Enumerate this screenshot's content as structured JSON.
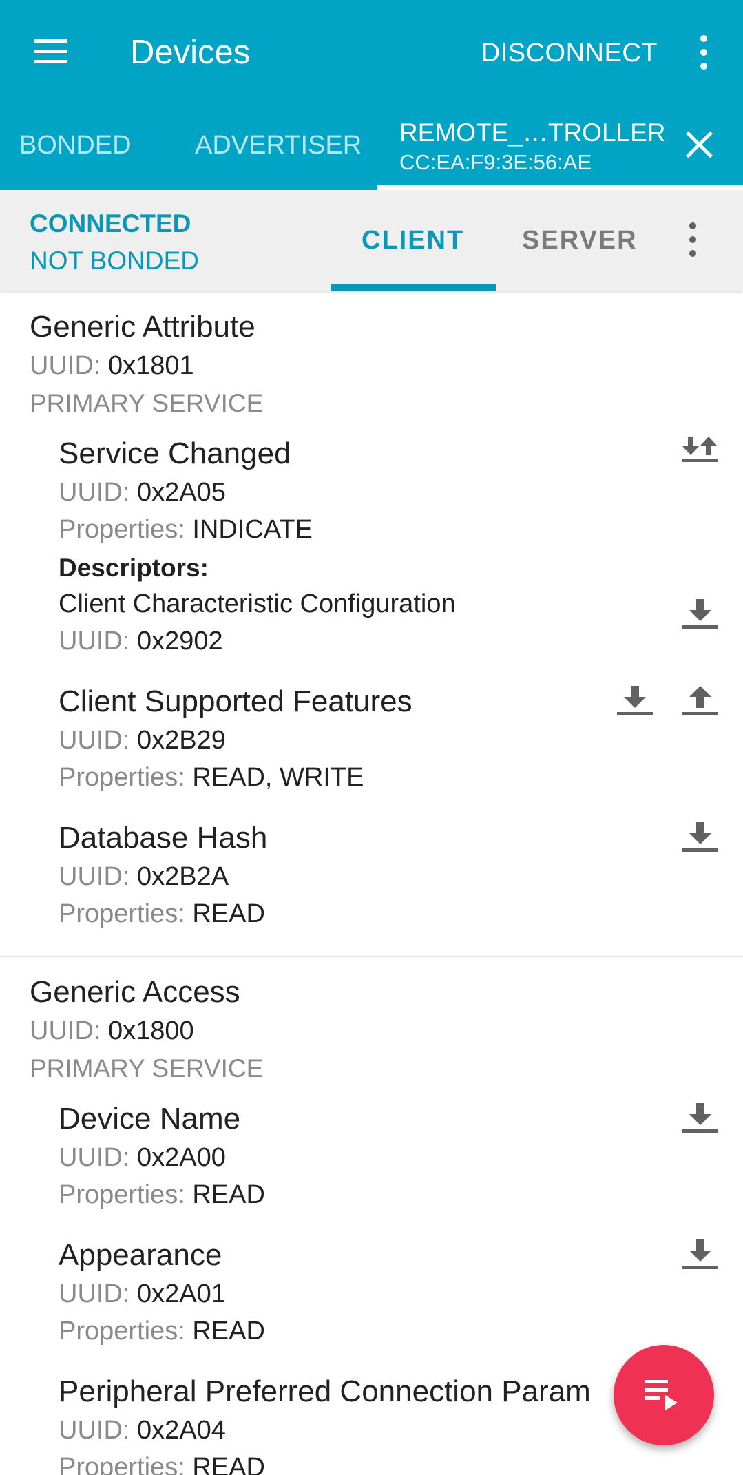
{
  "appbar": {
    "title": "Devices",
    "disconnect_label": "DISCONNECT",
    "icons": {
      "menu": "hamburger-menu-icon",
      "overflow": "more-vert-icon"
    }
  },
  "tabs": {
    "bonded": "BONDED",
    "advertiser": "ADVERTISER",
    "device_name": "REMOTE_…TROLLER",
    "device_address": "CC:EA:F9:3E:56:AE",
    "close_icon": "close-icon"
  },
  "status": {
    "connection": "CONNECTED",
    "bond": "NOT BONDED",
    "client_tab": "CLIENT",
    "server_tab": "SERVER"
  },
  "labels": {
    "uuid": "UUID:",
    "properties": "Properties:",
    "descriptors": "Descriptors:"
  },
  "services": [
    {
      "name": "Generic Attribute",
      "uuid": "0x1801",
      "type": "PRIMARY SERVICE",
      "characteristics": [
        {
          "name": "Service Changed",
          "uuid": "0x2A05",
          "properties": "INDICATE",
          "descriptor": {
            "name": "Client Characteristic Configuration",
            "uuid": "0x2902"
          }
        },
        {
          "name": "Client Supported Features",
          "uuid": "0x2B29",
          "properties": "READ, WRITE"
        },
        {
          "name": "Database Hash",
          "uuid": "0x2B2A",
          "properties": "READ"
        }
      ]
    },
    {
      "name": "Generic Access",
      "uuid": "0x1800",
      "type": "PRIMARY SERVICE",
      "characteristics": [
        {
          "name": "Device Name",
          "uuid": "0x2A00",
          "properties": "READ"
        },
        {
          "name": "Appearance",
          "uuid": "0x2A01",
          "properties": "READ"
        },
        {
          "name": "Peripheral Preferred Connection Param",
          "uuid": "0x2A04",
          "properties": "READ"
        }
      ]
    }
  ],
  "colors": {
    "appbar": "#02A4C6",
    "accent": "#0A97B8",
    "fab": "#EF3153",
    "icon_grey": "#616161"
  },
  "fab_icon": "playlist-play-icon"
}
